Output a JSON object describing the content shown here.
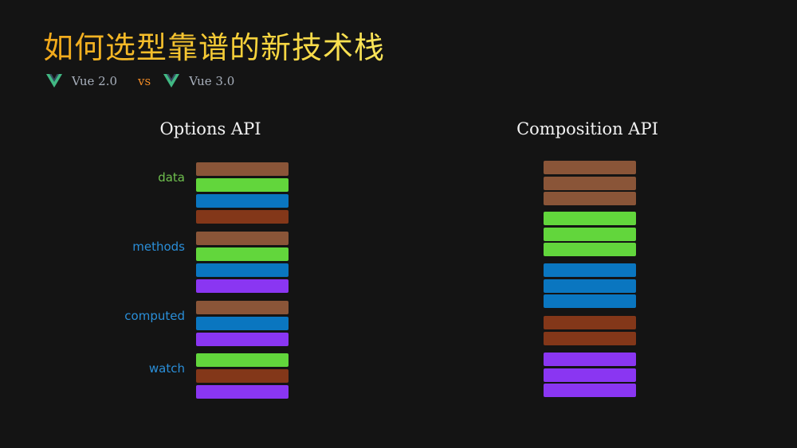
{
  "title": "如何选型靠谱的新技术栈",
  "subtitle": {
    "left": "Vue 2.0",
    "vs": "vs",
    "right": "Vue 3.0"
  },
  "colors": {
    "data": "#8a5538",
    "methods_green": "#62d63c",
    "blue": "#0a76c0",
    "rust": "#833719",
    "purple": "#8a36f2",
    "label_data": "#6fc04e",
    "label_blue": "#2a8ed8"
  },
  "options": {
    "heading": "Options API",
    "groups": [
      {
        "label": "data",
        "label_color": "#6fc04e",
        "bars": [
          "#8a5538",
          "#62d63c",
          "#0a76c0",
          "#833719"
        ]
      },
      {
        "label": "methods",
        "label_color": "#2a8ed8",
        "bars": [
          "#8a5538",
          "#62d63c",
          "#0a76c0",
          "#8a36f2"
        ]
      },
      {
        "label": "computed",
        "label_color": "#2a8ed8",
        "bars": [
          "#8a5538",
          "#0a76c0",
          "#8a36f2"
        ]
      },
      {
        "label": "watch",
        "label_color": "#2a8ed8",
        "bars": [
          "#62d63c",
          "#833719",
          "#8a36f2"
        ]
      }
    ]
  },
  "composition": {
    "heading": "Composition API",
    "groups": [
      {
        "bars": [
          "#8a5538",
          "#8a5538",
          "#8a5538"
        ]
      },
      {
        "bars": [
          "#62d63c",
          "#62d63c",
          "#62d63c"
        ]
      },
      {
        "bars": [
          "#0a76c0",
          "#0a76c0",
          "#0a76c0"
        ]
      },
      {
        "bars": [
          "#833719",
          "#833719"
        ]
      },
      {
        "bars": [
          "#8a36f2",
          "#8a36f2",
          "#8a36f2"
        ]
      }
    ]
  }
}
